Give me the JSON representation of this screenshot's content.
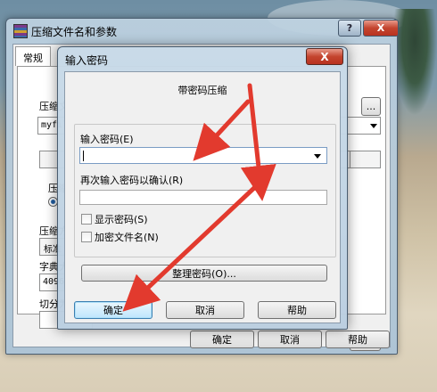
{
  "parent": {
    "title": "压缩文件名和参数",
    "help_symbol": "?",
    "close_symbol": "X",
    "tabs": [
      {
        "label": "常规"
      }
    ],
    "labels": {
      "archive_name_partial": "压缩文",
      "filename_partial": "myfil",
      "format_partial": "压缩",
      "method_partial": "压缩方",
      "method_value_partial": "标准",
      "dict_partial": "字典大",
      "dict_value_partial": "4096",
      "split_partial": "切分为"
    },
    "browse_label": "...",
    "buttons": {
      "ok": "确定",
      "cancel": "取消",
      "help": "帮助"
    }
  },
  "dialog": {
    "title": "输入密码",
    "close_symbol": "X",
    "heading": "带密码压缩",
    "password_label": "输入密码(E)",
    "confirm_label": "再次输入密码以确认(R)",
    "show_password": "显示密码(S)",
    "encrypt_names": "加密文件名(N)",
    "organize_button": "整理密码(O)...",
    "buttons": {
      "ok": "确定",
      "cancel": "取消",
      "help": "帮助"
    }
  },
  "colors": {
    "annotation_arrow": "#e23a2e"
  }
}
